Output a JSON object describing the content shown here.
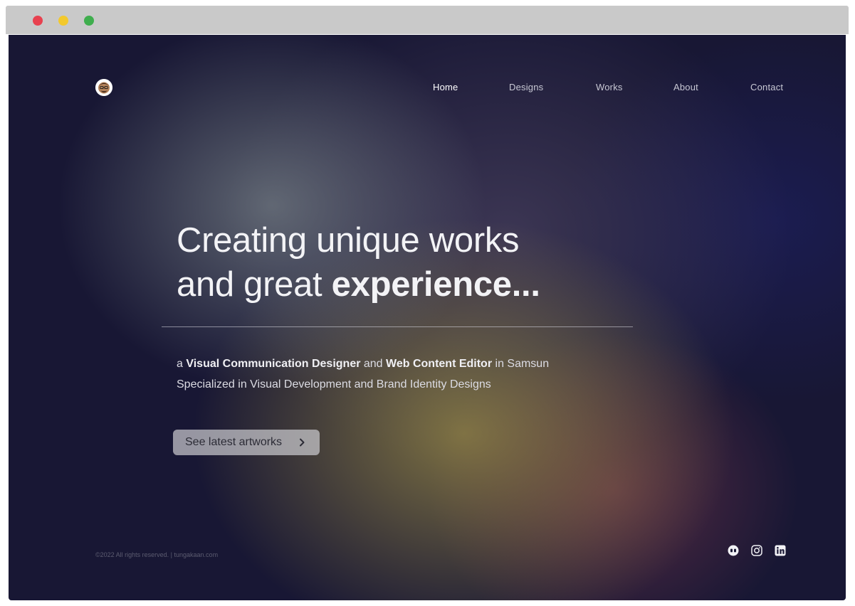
{
  "window": {
    "controls": [
      "close",
      "minimize",
      "maximize"
    ],
    "colors": {
      "close": "#e8414f",
      "minimize": "#f3c92d",
      "maximize": "#3fae4e"
    }
  },
  "header": {
    "logo_icon": "avatar-logo-icon",
    "nav": [
      {
        "label": "Home",
        "active": true
      },
      {
        "label": "Designs",
        "active": false
      },
      {
        "label": "Works",
        "active": false
      },
      {
        "label": "About",
        "active": false
      },
      {
        "label": "Contact",
        "active": false
      }
    ]
  },
  "hero": {
    "headline_line1": "Creating unique works",
    "headline_line2_prefix": "and great ",
    "headline_line2_bold": "experience...",
    "intro_prefix": "a ",
    "intro_role1": "Visual Communication Designer",
    "intro_and": " and ",
    "intro_role2": "Web Content Editor",
    "intro_location": " in Samsun",
    "intro_line2": "Specialized in Visual Development and Brand Identity Designs",
    "cta_label": "See latest artworks",
    "cta_icon": "chevron-right-icon"
  },
  "footer": {
    "copyright": "©2022 All rights reserved. | tungakaan.com",
    "social": [
      "dribbble-icon",
      "instagram-icon",
      "linkedin-icon"
    ]
  },
  "colors": {
    "background": "#181734",
    "text": "#f3f3f6",
    "button": "#cdcdd2"
  }
}
